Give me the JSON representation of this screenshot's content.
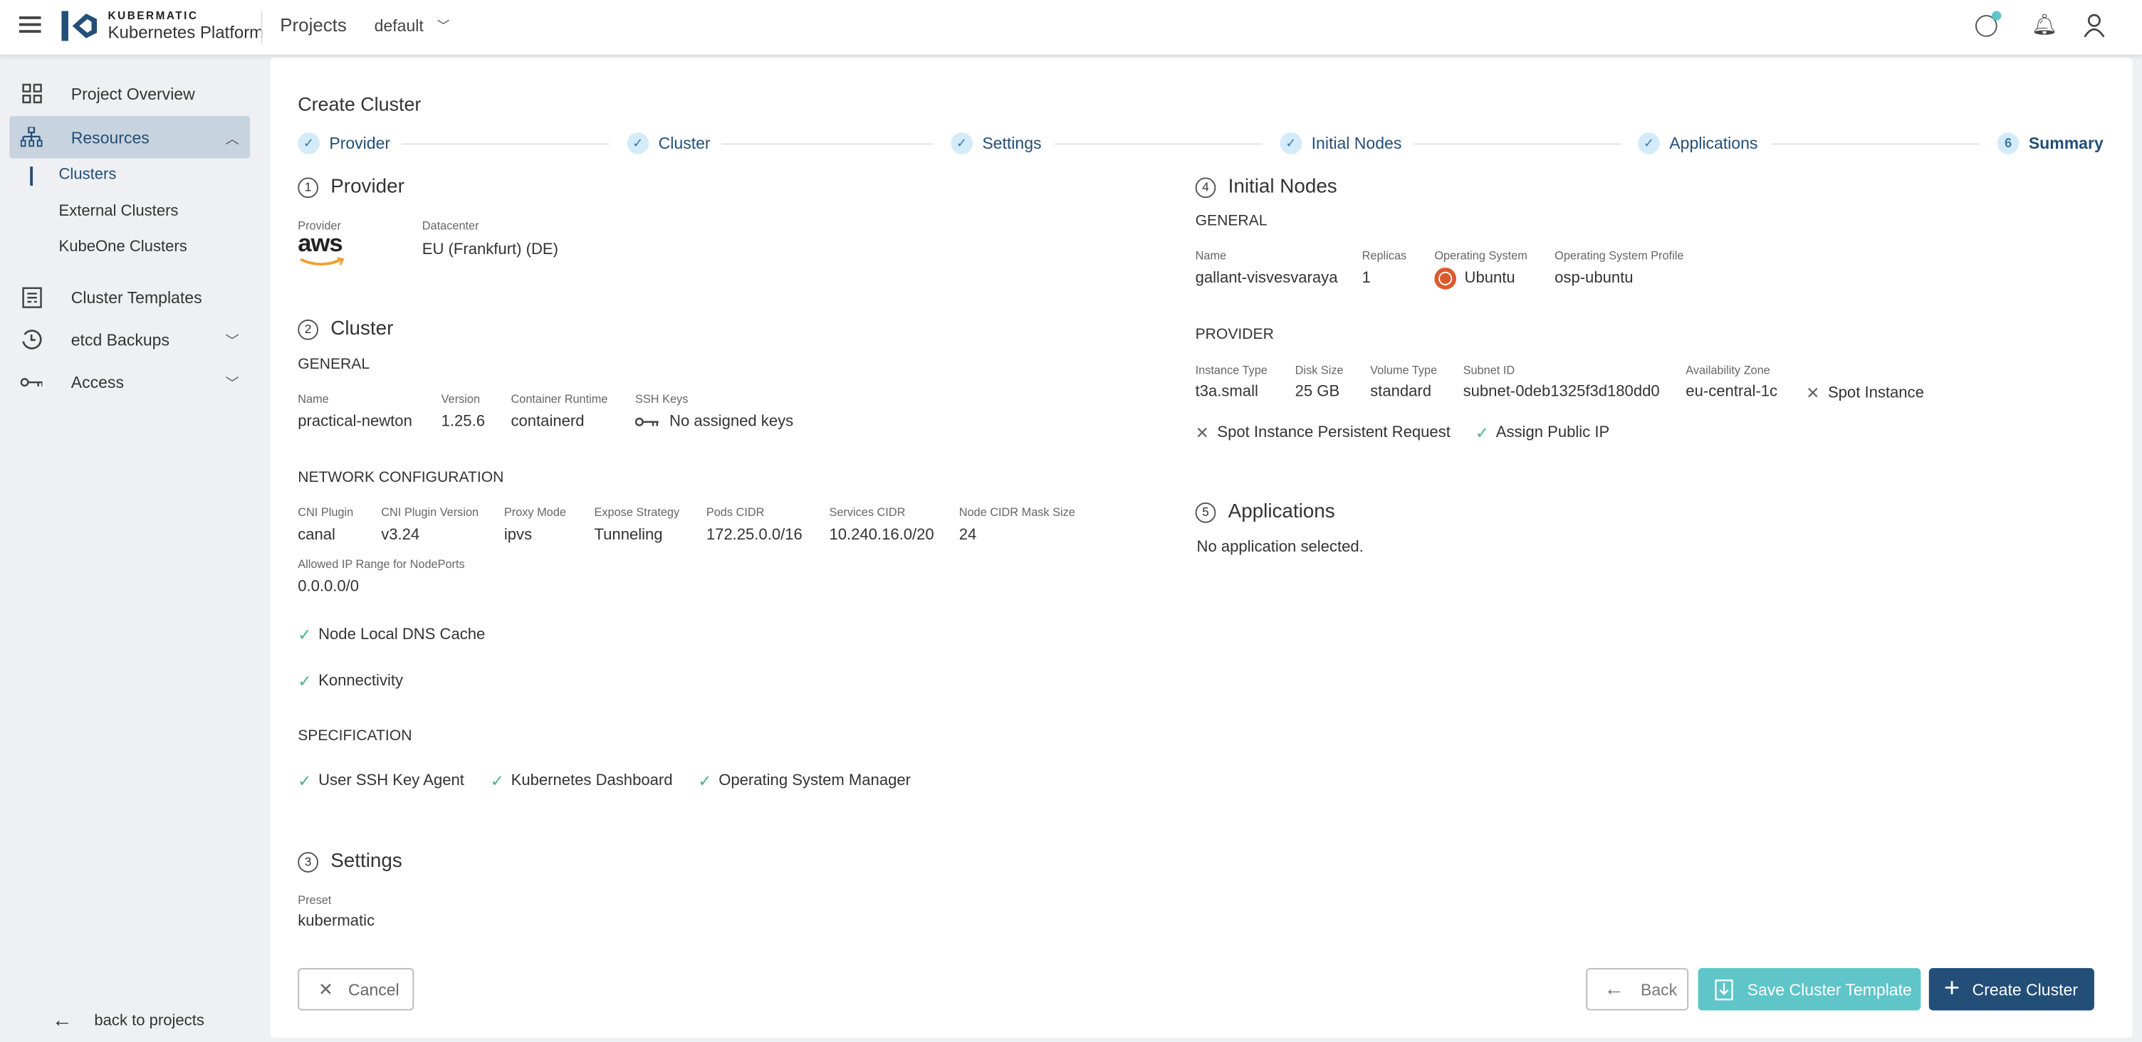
{
  "colors": {
    "primary": "#234e78",
    "accent": "#5fc5c9",
    "success": "#4caf8f",
    "sidebar": "#eef0f3"
  },
  "header": {
    "brand_top": "KUBERMATIC",
    "brand_bottom": "Kubernetes Platform",
    "projects": "Projects",
    "project": "default"
  },
  "sidebar": {
    "items": [
      {
        "label": "Project Overview",
        "icon": "grid-icon"
      },
      {
        "label": "Resources",
        "icon": "sitemap-icon"
      },
      {
        "label": "Cluster Templates",
        "icon": "template-icon"
      },
      {
        "label": "etcd Backups",
        "icon": "history-icon"
      },
      {
        "label": "Access",
        "icon": "key-icon"
      }
    ],
    "sub": [
      "Clusters",
      "External Clusters",
      "KubeOne Clusters"
    ],
    "back": "back to projects"
  },
  "page": {
    "title": "Create Cluster"
  },
  "steps": [
    {
      "label": "Provider",
      "mark": "✓"
    },
    {
      "label": "Cluster",
      "mark": "✓"
    },
    {
      "label": "Settings",
      "mark": "✓"
    },
    {
      "label": "Initial Nodes",
      "mark": "✓"
    },
    {
      "label": "Applications",
      "mark": "✓"
    },
    {
      "label": "Summary",
      "mark": "6"
    }
  ],
  "provider": {
    "num": "1",
    "title": "Provider",
    "provider_label": "Provider",
    "provider_value": "aws",
    "datacenter_label": "Datacenter",
    "datacenter_value": "EU (Frankfurt) (DE)"
  },
  "cluster": {
    "num": "2",
    "title": "Cluster",
    "general": "GENERAL",
    "fields": [
      {
        "label": "Name",
        "value": "practical-newton"
      },
      {
        "label": "Version",
        "value": "1.25.6"
      },
      {
        "label": "Container Runtime",
        "value": "containerd"
      },
      {
        "label": "SSH Keys",
        "value": "No assigned keys"
      }
    ],
    "network": "NETWORK CONFIGURATION",
    "net_fields": [
      {
        "label": "CNI Plugin",
        "value": "canal"
      },
      {
        "label": "CNI Plugin Version",
        "value": "v3.24"
      },
      {
        "label": "Proxy Mode",
        "value": "ipvs"
      },
      {
        "label": "Expose Strategy",
        "value": "Tunneling"
      },
      {
        "label": "Pods CIDR",
        "value": "172.25.0.0/16"
      },
      {
        "label": "Services CIDR",
        "value": "10.240.16.0/20"
      },
      {
        "label": "Node CIDR Mask Size",
        "value": "24"
      }
    ],
    "ip_range_label": "Allowed IP Range for NodePorts",
    "ip_range_value": "0.0.0.0/0",
    "node_local_dns": "Node Local DNS Cache",
    "konnectivity": "Konnectivity",
    "spec": "SPECIFICATION",
    "spec_items": [
      "User SSH Key Agent",
      "Kubernetes Dashboard",
      "Operating System Manager"
    ]
  },
  "settings": {
    "num": "3",
    "title": "Settings",
    "preset_label": "Preset",
    "preset_value": "kubermatic"
  },
  "nodes": {
    "num": "4",
    "title": "Initial Nodes",
    "general": "GENERAL",
    "fields": [
      {
        "label": "Name",
        "value": "gallant-visvesvaraya"
      },
      {
        "label": "Replicas",
        "value": "1"
      },
      {
        "label": "Operating System",
        "value": "Ubuntu"
      },
      {
        "label": "Operating System Profile",
        "value": "osp-ubuntu"
      }
    ],
    "provider": "PROVIDER",
    "prov_fields": [
      {
        "label": "Instance Type",
        "value": "t3a.small"
      },
      {
        "label": "Disk Size",
        "value": "25 GB"
      },
      {
        "label": "Volume Type",
        "value": "standard"
      },
      {
        "label": "Subnet ID",
        "value": "subnet-0deb1325f3d180dd0"
      },
      {
        "label": "Availability Zone",
        "value": "eu-central-1c"
      }
    ],
    "spot": "Spot Instance",
    "spot_persistent": "Spot Instance Persistent Request",
    "public_ip": "Assign Public IP"
  },
  "applications": {
    "num": "5",
    "title": "Applications",
    "empty": "No application selected."
  },
  "buttons": {
    "cancel": "Cancel",
    "back": "Back",
    "save_template": "Save Cluster Template",
    "create": "Create Cluster"
  }
}
